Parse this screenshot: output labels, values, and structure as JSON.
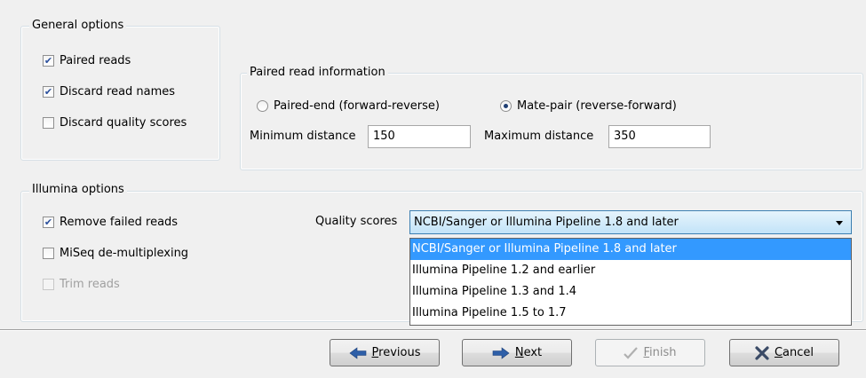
{
  "general_options": {
    "title": "General options",
    "paired_reads": {
      "label": "Paired reads",
      "checked": true
    },
    "discard_read_names": {
      "label": "Discard read names",
      "checked": true
    },
    "discard_quality_scores": {
      "label": "Discard quality scores",
      "checked": false
    }
  },
  "paired_read_info": {
    "title": "Paired read information",
    "paired_end_label": "Paired-end (forward-reverse)",
    "mate_pair_label": "Mate-pair (reverse-forward)",
    "selected": "mate-pair",
    "min_distance_label": "Minimum distance",
    "min_distance_value": "150",
    "max_distance_label": "Maximum distance",
    "max_distance_value": "350"
  },
  "illumina_options": {
    "title": "Illumina options",
    "remove_failed_reads": {
      "label": "Remove failed reads",
      "checked": true
    },
    "miseq_demultiplexing": {
      "label": "MiSeq de-multiplexing",
      "checked": false
    },
    "trim_reads": {
      "label": "Trim reads",
      "checked": false,
      "disabled": true
    },
    "quality_scores_label": "Quality scores",
    "quality_scores_value": "NCBI/Sanger or Illumina Pipeline 1.8 and later",
    "quality_scores_options": [
      "NCBI/Sanger or Illumina Pipeline 1.8 and later",
      "Illumina Pipeline 1.2 and earlier",
      "Illumina Pipeline 1.3 and 1.4",
      "Illumina Pipeline 1.5 to 1.7"
    ]
  },
  "buttons": {
    "previous": {
      "mnemonic": "P",
      "rest": "revious"
    },
    "next": {
      "mnemonic": "N",
      "rest": "ext"
    },
    "finish": {
      "mnemonic": "F",
      "rest": "inish"
    },
    "cancel": {
      "mnemonic": "C",
      "rest": "ancel"
    }
  },
  "colors": {
    "accent": "#3399ff",
    "check": "#2a4f9c",
    "arrow": "#2e5fa8",
    "cancel_x": "#3a4a66"
  }
}
